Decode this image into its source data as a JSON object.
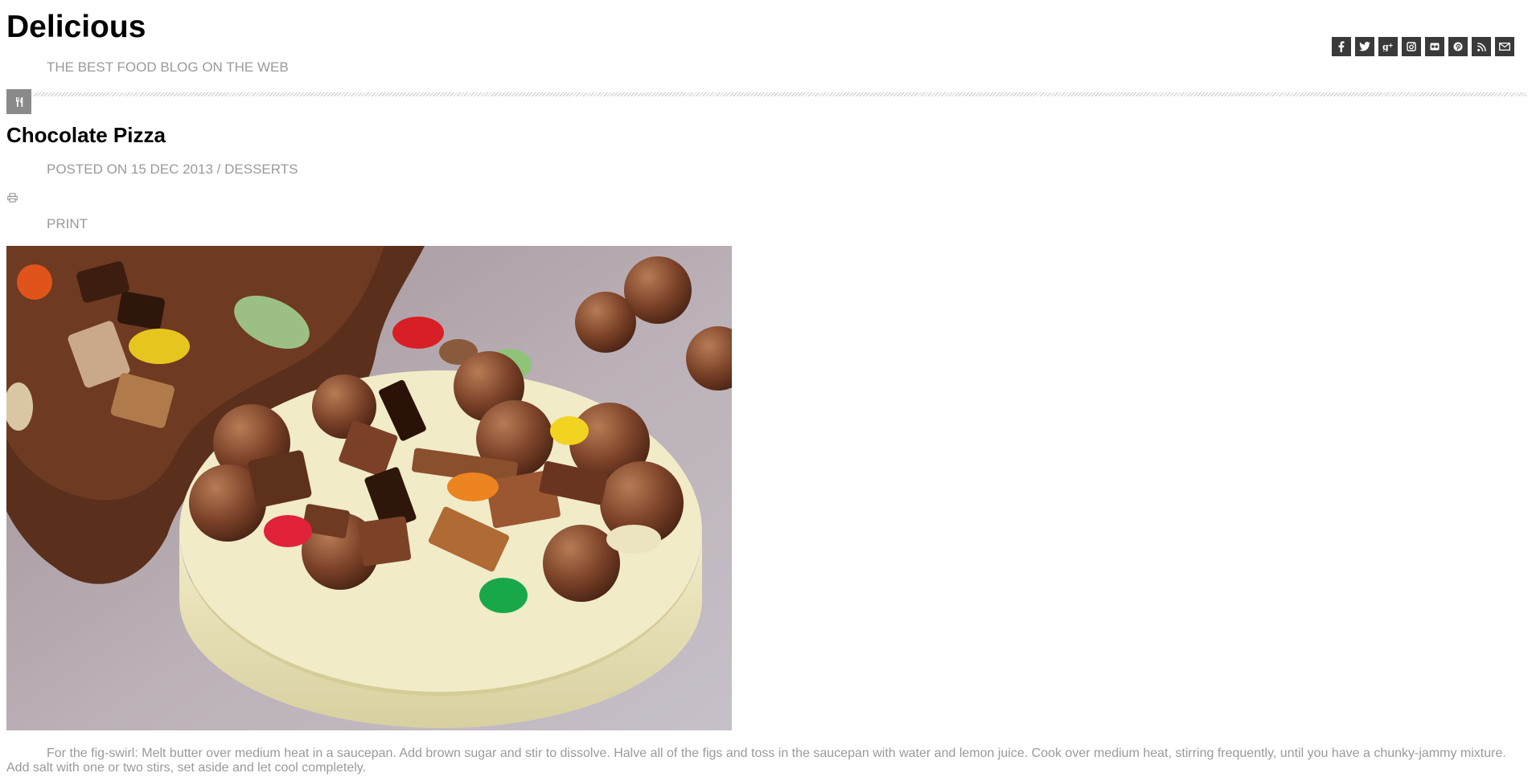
{
  "site": {
    "title": "Delicious",
    "tagline": "THE BEST FOOD BLOG ON THE WEB"
  },
  "social_icons": [
    {
      "name": "facebook-icon",
      "glyph": "f"
    },
    {
      "name": "twitter-icon",
      "glyph": "t"
    },
    {
      "name": "google-plus-icon",
      "glyph": "g+"
    },
    {
      "name": "instagram-icon",
      "glyph": "ig"
    },
    {
      "name": "flickr-icon",
      "glyph": "fl"
    },
    {
      "name": "pinterest-icon",
      "glyph": "p"
    },
    {
      "name": "rss-icon",
      "glyph": "rss"
    },
    {
      "name": "email-icon",
      "glyph": "mail"
    }
  ],
  "category_icon": "fork-knife-icon",
  "post": {
    "title": "Chocolate Pizza",
    "meta_prefix": "POSTED ON",
    "date": "15 DEC 2013",
    "separator": "/",
    "category": "DESSERTS",
    "print_label": "PRINT",
    "image_alt": "chocolate pizza photo",
    "body": "For the fig-swirl: Melt butter over medium heat in a saucepan. Add brown sugar and stir to dissolve. Halve all of the figs and toss in the saucepan with water and lemon juice. Cook over medium heat, stirring frequently, until you have a chunky-jammy mixture. Add salt with one or two stirs, set aside and let cool completely."
  },
  "colors": {
    "text_muted": "#9a9a9a",
    "icon_bg": "#3a3a3a",
    "category_icon_bg": "#8a8a8a"
  }
}
